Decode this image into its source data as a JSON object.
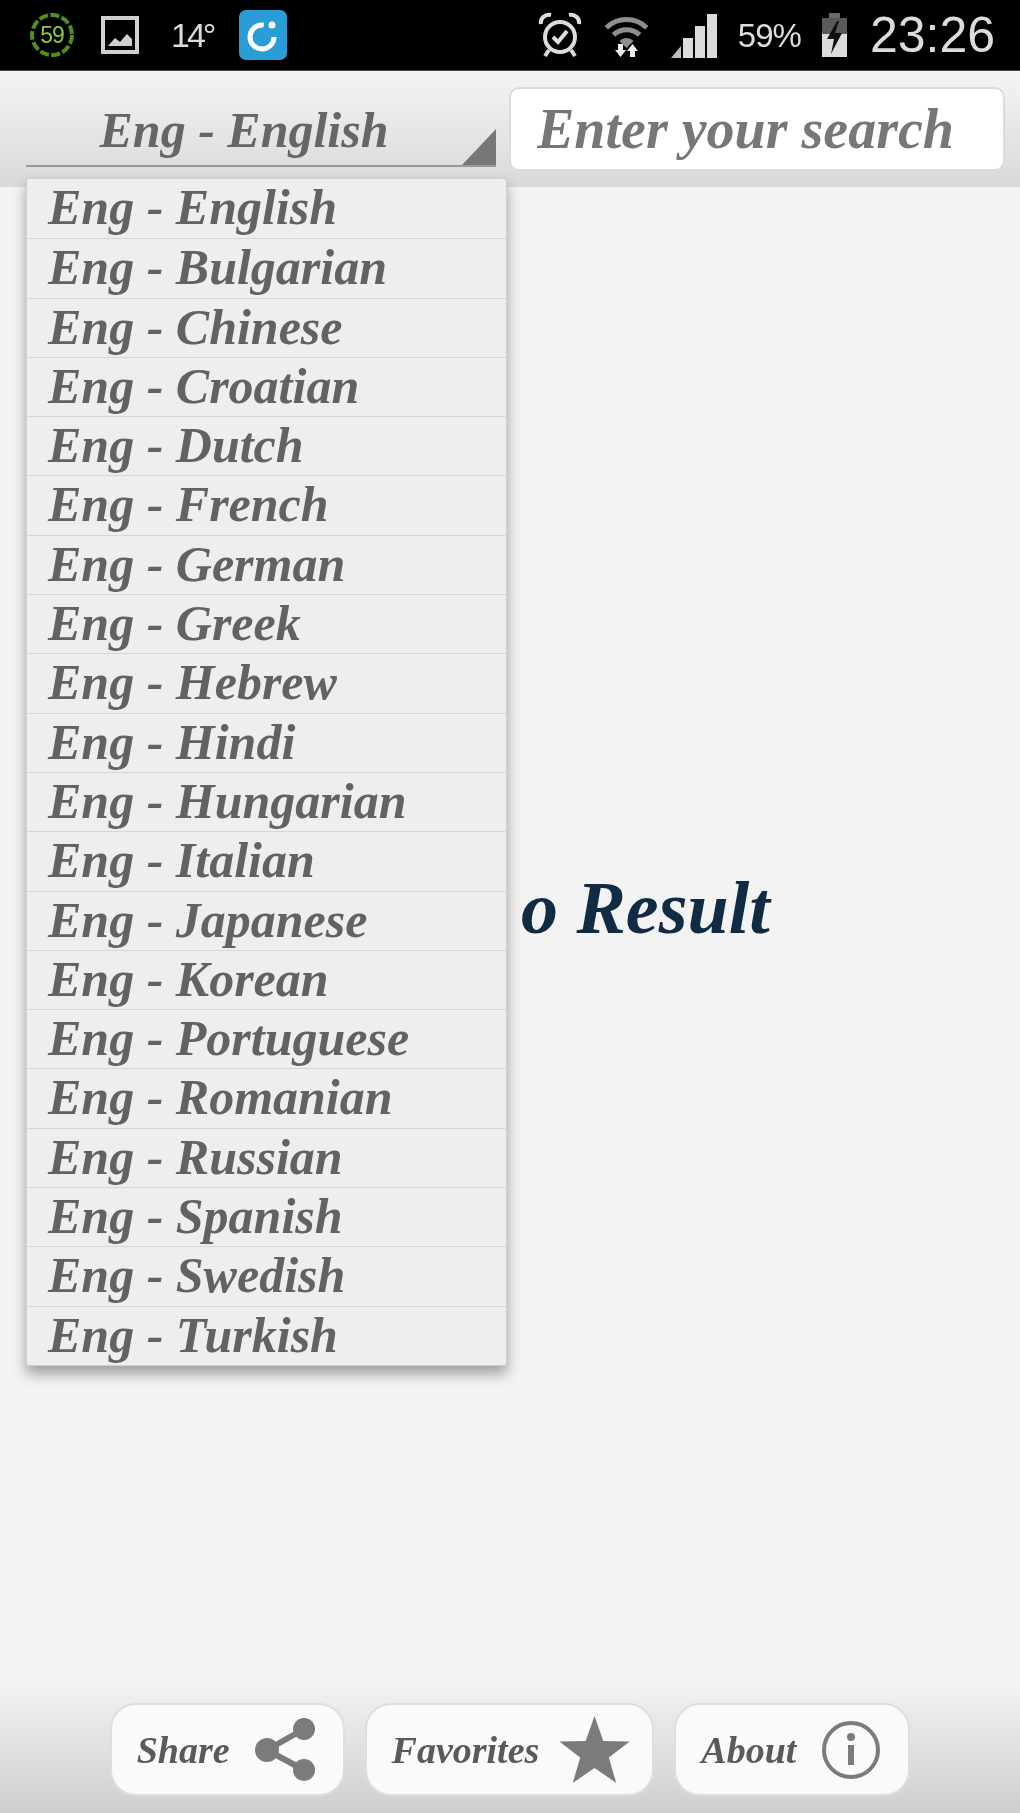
{
  "status_bar": {
    "ring_count": "59",
    "temperature": "14°",
    "battery": "59%",
    "time": "23:26"
  },
  "language_spinner": {
    "value": "Eng - English",
    "expanded": true
  },
  "search": {
    "placeholder": "Enter your search"
  },
  "language_list": [
    "Eng - English",
    "Eng - Bulgarian",
    "Eng - Chinese",
    "Eng - Croatian",
    "Eng - Dutch",
    "Eng - French",
    "Eng - German",
    "Eng - Greek",
    "Eng - Hebrew",
    "Eng - Hindi",
    "Eng - Hungarian",
    "Eng - Italian",
    "Eng - Japanese",
    "Eng - Korean",
    "Eng - Portuguese",
    "Eng - Romanian",
    "Eng - Russian",
    "Eng - Spanish",
    "Eng - Swedish",
    "Eng - Turkish"
  ],
  "result": {
    "message": "o Result"
  },
  "buttons": [
    {
      "label": "Share",
      "kind": "share"
    },
    {
      "label": "Favorites",
      "kind": "favorite"
    },
    {
      "label": "About",
      "kind": "info"
    }
  ]
}
